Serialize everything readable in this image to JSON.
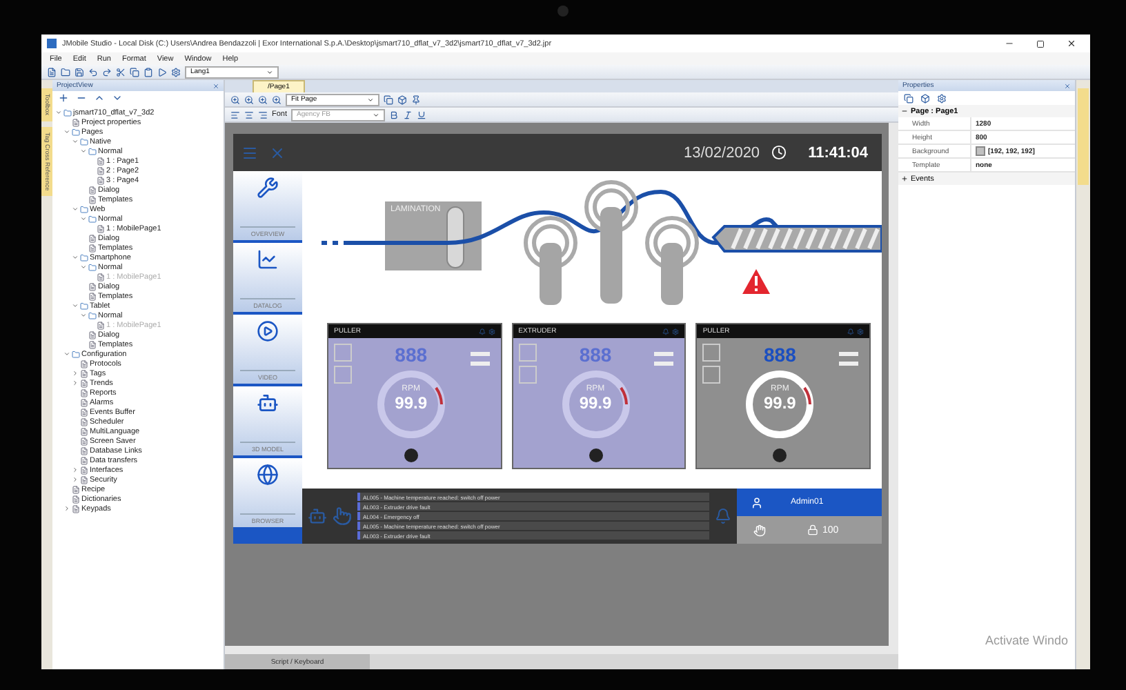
{
  "window": {
    "title": "JMobile Studio - Local Disk (C:) Users\\Andrea Bendazzoli | Exor International S.p.A.\\Desktop\\jsmart710_dflat_v7_3d2\\jsmart710_dflat_v7_3d2.jpr"
  },
  "menu": [
    "File",
    "Edit",
    "Run",
    "Format",
    "View",
    "Window",
    "Help"
  ],
  "toolbar": {
    "language": "Lang1"
  },
  "side_tabs": [
    "Toolbox",
    "Tag Cross Reference"
  ],
  "project_view": {
    "title": "ProjectView",
    "tree": [
      {
        "label": "jsmart710_dflat_v7_3d2",
        "expanded": true,
        "children": [
          {
            "label": "Project properties"
          },
          {
            "label": "Pages",
            "expanded": true,
            "children": [
              {
                "label": "Native",
                "expanded": true,
                "children": [
                  {
                    "label": "Normal",
                    "expanded": true,
                    "children": [
                      {
                        "label": "1 : Page1"
                      },
                      {
                        "label": "2 : Page2"
                      },
                      {
                        "label": "3 : Page4"
                      }
                    ]
                  },
                  {
                    "label": "Dialog"
                  },
                  {
                    "label": "Templates"
                  }
                ]
              },
              {
                "label": "Web",
                "expanded": true,
                "children": [
                  {
                    "label": "Normal",
                    "expanded": true,
                    "children": [
                      {
                        "label": "1 : MobilePage1"
                      }
                    ]
                  },
                  {
                    "label": "Dialog"
                  },
                  {
                    "label": "Templates"
                  }
                ]
              },
              {
                "label": "Smartphone",
                "expanded": true,
                "children": [
                  {
                    "label": "Normal",
                    "expanded": true,
                    "children": [
                      {
                        "label": "1 : MobilePage1",
                        "disabled": true
                      }
                    ]
                  },
                  {
                    "label": "Dialog"
                  },
                  {
                    "label": "Templates"
                  }
                ]
              },
              {
                "label": "Tablet",
                "expanded": true,
                "children": [
                  {
                    "label": "Normal",
                    "expanded": true,
                    "children": [
                      {
                        "label": "1 : MobilePage1",
                        "disabled": true
                      }
                    ]
                  },
                  {
                    "label": "Dialog"
                  },
                  {
                    "label": "Templates"
                  }
                ]
              }
            ]
          },
          {
            "label": "Configuration",
            "expanded": true,
            "children": [
              {
                "label": "Protocols"
              },
              {
                "label": "Tags",
                "expanded": false
              },
              {
                "label": "Trends",
                "expanded": false
              },
              {
                "label": "Reports"
              },
              {
                "label": "Alarms"
              },
              {
                "label": "Events Buffer"
              },
              {
                "label": "Scheduler"
              },
              {
                "label": "MultiLanguage"
              },
              {
                "label": "Screen Saver"
              },
              {
                "label": "Database Links"
              },
              {
                "label": "Data transfers"
              },
              {
                "label": "Interfaces",
                "expanded": false
              },
              {
                "label": "Security",
                "expanded": false
              }
            ]
          },
          {
            "label": "Recipe"
          },
          {
            "label": "Dictionaries"
          },
          {
            "label": "Keypads",
            "expanded": false
          }
        ]
      }
    ]
  },
  "editor": {
    "tab": "/Page1",
    "zoom": "Fit Page",
    "font_label": "Font",
    "font": "Agency FB",
    "bottom_tab": "Script / Keyboard"
  },
  "hmi": {
    "date": "13/02/2020",
    "time": "11:41:04",
    "nav": [
      "OVERVIEW",
      "DATALOG",
      "VIDEO",
      "3D MODEL",
      "BROWSER"
    ],
    "lamination": "LAMINATION",
    "panels": [
      {
        "title": "PULLER",
        "setpoint": "888",
        "unit": "RPM",
        "value": "99.9",
        "selected": true
      },
      {
        "title": "EXTRUDER",
        "setpoint": "888",
        "unit": "RPM",
        "value": "99.9",
        "selected": true
      },
      {
        "title": "PULLER",
        "setpoint": "888",
        "unit": "RPM",
        "value": "99.9",
        "selected": false
      }
    ],
    "alarms": [
      "AL005 - Machine temperature reached: switch off power",
      "AL003 - Extruder drive fault",
      "AL004 - Emergency off",
      "AL005 - Machine temperature reached: switch off power",
      "AL003 - Extruder drive fault"
    ],
    "user": "Admin01",
    "count": "100"
  },
  "properties": {
    "title": "Properties",
    "group": "Page : Page1",
    "rows": [
      {
        "name": "Width",
        "value": "1280",
        "kind": "text"
      },
      {
        "name": "Height",
        "value": "800",
        "kind": "text"
      },
      {
        "name": "Background",
        "value": "[192, 192, 192]",
        "kind": "color",
        "color": "#c0c0c0"
      },
      {
        "name": "Template",
        "value": "none",
        "kind": "text"
      }
    ],
    "events": "Events"
  },
  "overlay": "Activate Windo"
}
